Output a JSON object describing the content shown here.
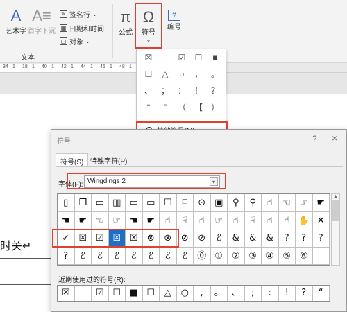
{
  "ribbon": {
    "wordart_label": "艺术字",
    "dropcap_label": "首字下沉",
    "signature_label": "签名行",
    "datetime_label": "日期和时间",
    "object_label": "对象",
    "group_text_label": "文本",
    "equation_label": "公式",
    "symbol_label": "符号",
    "numbering_label": "编号",
    "numbering_icon": "#",
    "equation_icon": "π",
    "symbol_icon": "Ω"
  },
  "ruler": {
    "ticks": [
      "34",
      "1",
      "18",
      "1",
      "40",
      "1",
      "42",
      "1",
      "44",
      "1",
      "46",
      "1",
      "48",
      "1"
    ]
  },
  "document": {
    "text": "时关↵"
  },
  "symbol_gallery": {
    "symbols": [
      "☒",
      "",
      "☑",
      "☐",
      "■",
      "☐",
      "△",
      "○",
      "，",
      "。",
      "、",
      "；",
      "：",
      "！",
      "？",
      "“",
      "”",
      "（",
      "【",
      "）"
    ],
    "more_symbols_label": "其他符号(M)..."
  },
  "symbol_dialog": {
    "title": "符号",
    "help": "?",
    "close": "×",
    "tabs": [
      "符号(S)",
      "特殊字符(P)"
    ],
    "font_label": "字体(F):",
    "font_value": "Wingdings 2",
    "grid_rows": [
      [
        "▯",
        "❐",
        "▭",
        "▥",
        "▭",
        "▭",
        "☐",
        "⌸",
        "⊙",
        "▣",
        "⚲",
        "⚲",
        "☝",
        "☜",
        "☞",
        "☛"
      ],
      [
        "☚",
        "☛",
        "☜",
        "☞",
        "☚",
        "☛",
        "☝",
        "☟",
        "☝",
        "☞",
        "☝",
        "☟",
        "☝",
        "☝",
        "✋",
        "✕"
      ],
      [
        "✓",
        "☒",
        "☑",
        "☒",
        "☒",
        "⊗",
        "⊗",
        "⊘",
        "⊘",
        "ℰ",
        "&",
        "&",
        "&",
        "?",
        "?",
        "?"
      ],
      [
        "?",
        "ℰ",
        "ℰ",
        "ℰ",
        "ℰ",
        "ℰ",
        "ℰ",
        "ℰ",
        "⓪",
        "①",
        "②",
        "③",
        "④",
        "⑤",
        "⑥",
        ""
      ]
    ],
    "selected_cell": "3",
    "recent_label": "近期使用过的符号(R):",
    "recent": [
      "☒",
      "",
      "☑",
      "☐",
      "■",
      "☐",
      "△",
      "○",
      ",",
      "。",
      "、",
      ";",
      ":",
      "!",
      "?",
      "“"
    ]
  },
  "colors": {
    "highlight": "#e0412f",
    "selection": "#1f6fc4"
  }
}
